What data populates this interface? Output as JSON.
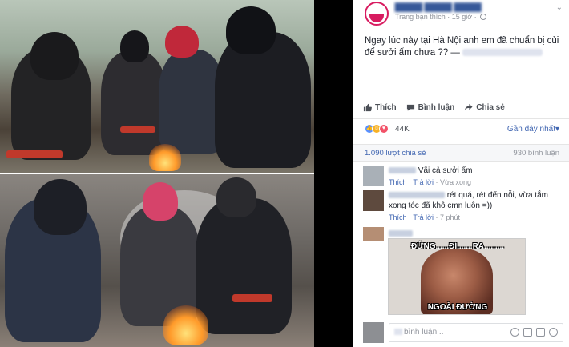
{
  "post": {
    "time": "15 giờ",
    "shared_via": "Trang bạn thích",
    "text": "Ngay lúc này tại Hà Nội anh em đã chuẩn bị củi để sưởi ấm chưa ?? —",
    "actions": {
      "like": "Thích",
      "comment": "Bình luận",
      "share": "Chia sẻ"
    },
    "reactions": {
      "count": "44K",
      "sort": "Gần đây nhất"
    },
    "stats": {
      "shares": "1.090 lượt chia sẻ",
      "comments": "930 bình luận"
    }
  },
  "comments": [
    {
      "text": "Vãi cả sưởi ấm",
      "like": "Thích",
      "reply": "Trả lời",
      "time": "Vừa xong"
    },
    {
      "text": "rét quá, rét đến nỗi, vừa tắm xong tóc đã khô cmn luôn =))",
      "like": "Thích",
      "reply": "Trả lời",
      "time": "7 phút"
    }
  ],
  "meme": {
    "top_caption": "ĐỨNG......ĐI.......RA.........",
    "bottom_caption": "NGOÀI ĐƯỜNG"
  },
  "compose": {
    "placeholder": "bình luận..."
  },
  "icons": {
    "like": "thumbs-up-icon",
    "comment": "speech-bubble-icon",
    "share": "share-arrow-icon",
    "privacy": "globe-icon"
  },
  "colors": {
    "link": "#4267b2",
    "page_accent": "#d81b60"
  }
}
